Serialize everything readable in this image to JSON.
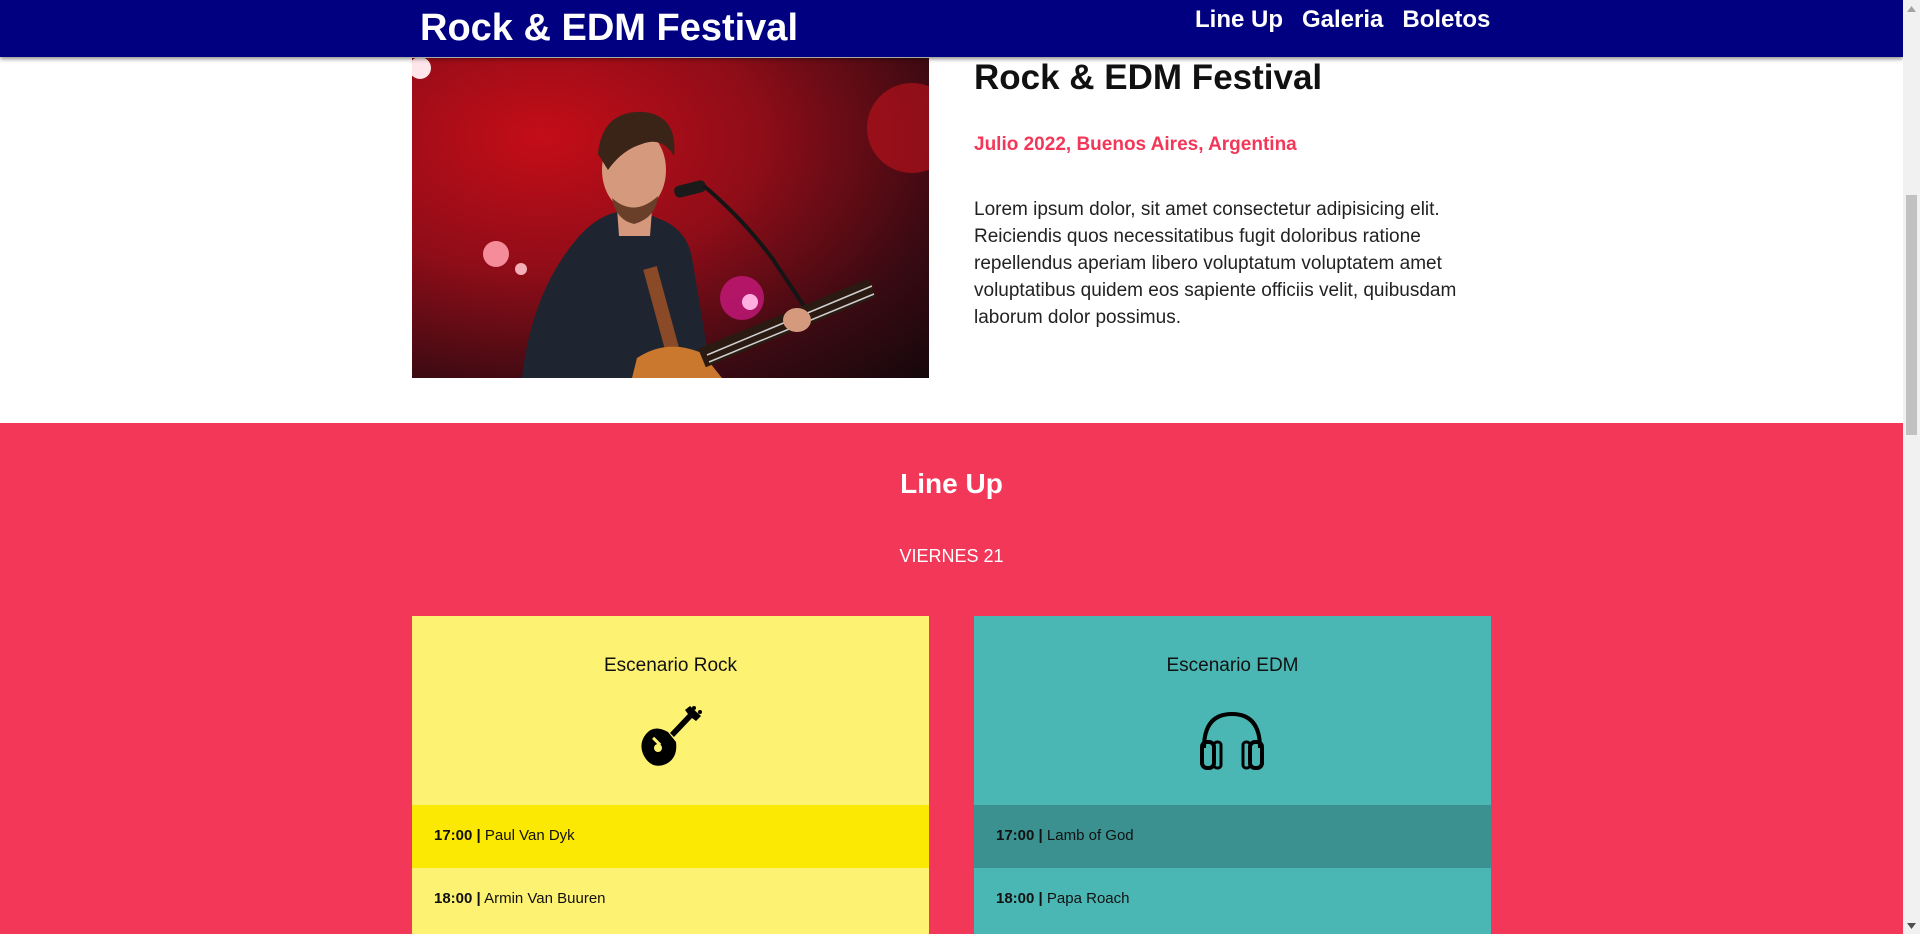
{
  "header": {
    "brand": "Rock & EDM Festival",
    "nav": [
      "Line Up",
      "Galeria",
      "Boletos"
    ]
  },
  "about": {
    "image_icon": "concert-photo",
    "title": "Rock & EDM Festival",
    "subtitle": "Julio 2022, Buenos Aires, Argentina",
    "description": "Lorem ipsum dolor, sit amet consectetur adipisicing elit. Reiciendis quos necessitatibus fugit doloribus ratione repellendus aperiam libero voluptatum voluptatem amet voluptatibus quidem eos sapiente officiis velit, quibusdam laborum dolor possimus."
  },
  "lineup": {
    "title": "Line Up",
    "day": "VIERNES 21",
    "stages": [
      {
        "name": "Escenario Rock",
        "icon": "guitar-icon",
        "slots": [
          {
            "time": "17:00 |",
            "artist": "Paul Van Dyk"
          },
          {
            "time": "18:00 |",
            "artist": "Armin Van Buuren"
          }
        ]
      },
      {
        "name": "Escenario EDM",
        "icon": "headphones-icon",
        "slots": [
          {
            "time": "17:00 |",
            "artist": "Lamb of God"
          },
          {
            "time": "18:00 |",
            "artist": "Papa Roach"
          }
        ]
      }
    ]
  },
  "colors": {
    "header_bg": "#000080",
    "accent_pink": "#f23758",
    "rock_stage": "#fef272",
    "rock_slot_dark": "#fbe903",
    "edm_stage": "#4bb7b4",
    "edm_slot_dark": "#3a918f"
  }
}
